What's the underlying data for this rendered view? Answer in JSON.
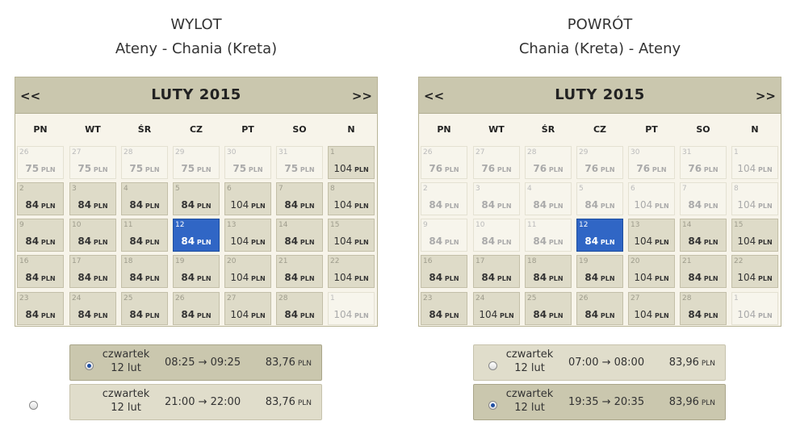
{
  "outbound": {
    "title": "WYLOT",
    "route": "Ateny - Chania (Kreta)",
    "calendar": {
      "month": "LUTY 2015",
      "prev": "<<",
      "next": ">>",
      "weekdays": [
        "PN",
        "WT",
        "ŚR",
        "CZ",
        "PT",
        "SO",
        "N"
      ],
      "weeks": [
        [
          {
            "d": "26",
            "p": "75",
            "c": "PLN",
            "s": "off"
          },
          {
            "d": "27",
            "p": "75",
            "c": "PLN",
            "s": "off"
          },
          {
            "d": "28",
            "p": "75",
            "c": "PLN",
            "s": "off"
          },
          {
            "d": "29",
            "p": "75",
            "c": "PLN",
            "s": "off"
          },
          {
            "d": "30",
            "p": "75",
            "c": "PLN",
            "s": "off"
          },
          {
            "d": "31",
            "p": "75",
            "c": "PLN",
            "s": "off"
          },
          {
            "d": "1",
            "p": "104",
            "c": "PLN",
            "s": "on"
          }
        ],
        [
          {
            "d": "2",
            "p": "84",
            "c": "PLN",
            "s": "on"
          },
          {
            "d": "3",
            "p": "84",
            "c": "PLN",
            "s": "on"
          },
          {
            "d": "4",
            "p": "84",
            "c": "PLN",
            "s": "on"
          },
          {
            "d": "5",
            "p": "84",
            "c": "PLN",
            "s": "on"
          },
          {
            "d": "6",
            "p": "104",
            "c": "PLN",
            "s": "on"
          },
          {
            "d": "7",
            "p": "84",
            "c": "PLN",
            "s": "on"
          },
          {
            "d": "8",
            "p": "104",
            "c": "PLN",
            "s": "on"
          }
        ],
        [
          {
            "d": "9",
            "p": "84",
            "c": "PLN",
            "s": "on"
          },
          {
            "d": "10",
            "p": "84",
            "c": "PLN",
            "s": "on"
          },
          {
            "d": "11",
            "p": "84",
            "c": "PLN",
            "s": "on"
          },
          {
            "d": "12",
            "p": "84",
            "c": "PLN",
            "s": "sel"
          },
          {
            "d": "13",
            "p": "104",
            "c": "PLN",
            "s": "on"
          },
          {
            "d": "14",
            "p": "84",
            "c": "PLN",
            "s": "on"
          },
          {
            "d": "15",
            "p": "104",
            "c": "PLN",
            "s": "on"
          }
        ],
        [
          {
            "d": "16",
            "p": "84",
            "c": "PLN",
            "s": "on"
          },
          {
            "d": "17",
            "p": "84",
            "c": "PLN",
            "s": "on"
          },
          {
            "d": "18",
            "p": "84",
            "c": "PLN",
            "s": "on"
          },
          {
            "d": "19",
            "p": "84",
            "c": "PLN",
            "s": "on"
          },
          {
            "d": "20",
            "p": "104",
            "c": "PLN",
            "s": "on"
          },
          {
            "d": "21",
            "p": "84",
            "c": "PLN",
            "s": "on"
          },
          {
            "d": "22",
            "p": "104",
            "c": "PLN",
            "s": "on"
          }
        ],
        [
          {
            "d": "23",
            "p": "84",
            "c": "PLN",
            "s": "on"
          },
          {
            "d": "24",
            "p": "84",
            "c": "PLN",
            "s": "on"
          },
          {
            "d": "25",
            "p": "84",
            "c": "PLN",
            "s": "on"
          },
          {
            "d": "26",
            "p": "84",
            "c": "PLN",
            "s": "on"
          },
          {
            "d": "27",
            "p": "104",
            "c": "PLN",
            "s": "on"
          },
          {
            "d": "28",
            "p": "84",
            "c": "PLN",
            "s": "on"
          },
          {
            "d": "1",
            "p": "104",
            "c": "PLN",
            "s": "off"
          }
        ]
      ]
    },
    "flights": [
      {
        "day": "czwartek",
        "date": "12 lut",
        "time": "08:25 → 09:25",
        "price": "83,76",
        "cur": "PLN",
        "selected": true
      },
      {
        "day": "czwartek",
        "date": "12 lut",
        "time": "21:00 → 22:00",
        "price": "83,76",
        "cur": "PLN",
        "selected": false
      }
    ]
  },
  "return": {
    "title": "POWRÓT",
    "route": "Chania (Kreta) - Ateny",
    "calendar": {
      "month": "LUTY 2015",
      "prev": "<<",
      "next": ">>",
      "weekdays": [
        "PN",
        "WT",
        "ŚR",
        "CZ",
        "PT",
        "SO",
        "N"
      ],
      "weeks": [
        [
          {
            "d": "26",
            "p": "76",
            "c": "PLN",
            "s": "off"
          },
          {
            "d": "27",
            "p": "76",
            "c": "PLN",
            "s": "off"
          },
          {
            "d": "28",
            "p": "76",
            "c": "PLN",
            "s": "off"
          },
          {
            "d": "29",
            "p": "76",
            "c": "PLN",
            "s": "off"
          },
          {
            "d": "30",
            "p": "76",
            "c": "PLN",
            "s": "off"
          },
          {
            "d": "31",
            "p": "76",
            "c": "PLN",
            "s": "off"
          },
          {
            "d": "1",
            "p": "104",
            "c": "PLN",
            "s": "off"
          }
        ],
        [
          {
            "d": "2",
            "p": "84",
            "c": "PLN",
            "s": "off"
          },
          {
            "d": "3",
            "p": "84",
            "c": "PLN",
            "s": "off"
          },
          {
            "d": "4",
            "p": "84",
            "c": "PLN",
            "s": "off"
          },
          {
            "d": "5",
            "p": "84",
            "c": "PLN",
            "s": "off"
          },
          {
            "d": "6",
            "p": "104",
            "c": "PLN",
            "s": "off"
          },
          {
            "d": "7",
            "p": "84",
            "c": "PLN",
            "s": "off"
          },
          {
            "d": "8",
            "p": "104",
            "c": "PLN",
            "s": "off"
          }
        ],
        [
          {
            "d": "9",
            "p": "84",
            "c": "PLN",
            "s": "off"
          },
          {
            "d": "10",
            "p": "84",
            "c": "PLN",
            "s": "off"
          },
          {
            "d": "11",
            "p": "84",
            "c": "PLN",
            "s": "off"
          },
          {
            "d": "12",
            "p": "84",
            "c": "PLN",
            "s": "sel"
          },
          {
            "d": "13",
            "p": "104",
            "c": "PLN",
            "s": "on"
          },
          {
            "d": "14",
            "p": "84",
            "c": "PLN",
            "s": "on"
          },
          {
            "d": "15",
            "p": "104",
            "c": "PLN",
            "s": "on"
          }
        ],
        [
          {
            "d": "16",
            "p": "84",
            "c": "PLN",
            "s": "on"
          },
          {
            "d": "17",
            "p": "84",
            "c": "PLN",
            "s": "on"
          },
          {
            "d": "18",
            "p": "84",
            "c": "PLN",
            "s": "on"
          },
          {
            "d": "19",
            "p": "84",
            "c": "PLN",
            "s": "on"
          },
          {
            "d": "20",
            "p": "104",
            "c": "PLN",
            "s": "on"
          },
          {
            "d": "21",
            "p": "84",
            "c": "PLN",
            "s": "on"
          },
          {
            "d": "22",
            "p": "104",
            "c": "PLN",
            "s": "on"
          }
        ],
        [
          {
            "d": "23",
            "p": "84",
            "c": "PLN",
            "s": "on"
          },
          {
            "d": "24",
            "p": "104",
            "c": "PLN",
            "s": "on"
          },
          {
            "d": "25",
            "p": "84",
            "c": "PLN",
            "s": "on"
          },
          {
            "d": "26",
            "p": "84",
            "c": "PLN",
            "s": "on"
          },
          {
            "d": "27",
            "p": "104",
            "c": "PLN",
            "s": "on"
          },
          {
            "d": "28",
            "p": "84",
            "c": "PLN",
            "s": "on"
          },
          {
            "d": "1",
            "p": "104",
            "c": "PLN",
            "s": "off"
          }
        ]
      ]
    },
    "flights": [
      {
        "day": "czwartek",
        "date": "12 lut",
        "time": "07:00 → 08:00",
        "price": "83,96",
        "cur": "PLN",
        "selected": false
      },
      {
        "day": "czwartek",
        "date": "12 lut",
        "time": "19:35 → 20:35",
        "price": "83,96",
        "cur": "PLN",
        "selected": true
      }
    ]
  }
}
